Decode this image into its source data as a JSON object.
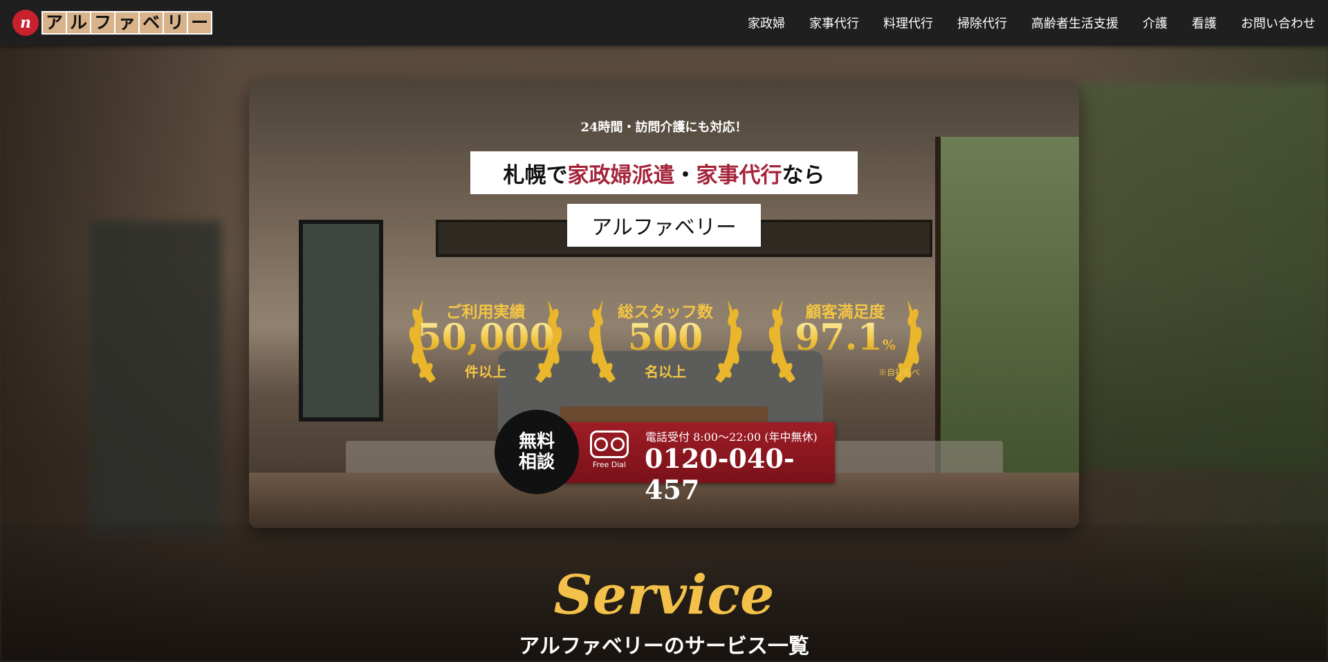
{
  "header": {
    "logo_mark": "n",
    "logo_chars": [
      "ア",
      "ル",
      "フ",
      "ァ",
      "ベ",
      "リ",
      "ー"
    ],
    "nav": [
      "家政婦",
      "家事代行",
      "料理代行",
      "掃除代行",
      "高齢者生活支援",
      "介護",
      "看護",
      "お問い合わせ"
    ]
  },
  "hero": {
    "tagline": "24時間・訪問介護にも対応！",
    "title_prefix": "札幌で",
    "title_accent1": "家政婦派遣",
    "title_sep": "・",
    "title_accent2": "家事代行",
    "title_suffix": "なら",
    "name": "アルファベリー",
    "stats": [
      {
        "label": "ご利用実績",
        "value": "50,000",
        "unit": "",
        "sub": "件以上"
      },
      {
        "label": "総スタッフ数",
        "value": "500",
        "unit": "",
        "sub": "名以上"
      },
      {
        "label": "顧客満足度",
        "value": "97.1",
        "unit": "%",
        "sub": "",
        "note": "※自社調べ"
      }
    ],
    "cta": {
      "circle_line1": "無料",
      "circle_line2": "相談",
      "freedial_label": "Free Dial",
      "hours": "電話受付 8:00～22:00 (年中無休)",
      "phone": "0120-040-457"
    }
  },
  "service": {
    "title": "Service",
    "subtitle": "アルファベリーのサービス一覧"
  },
  "colors": {
    "accent_red": "#a4243a",
    "gold": "#f3c545",
    "header_bg": "#1f1f1f"
  }
}
